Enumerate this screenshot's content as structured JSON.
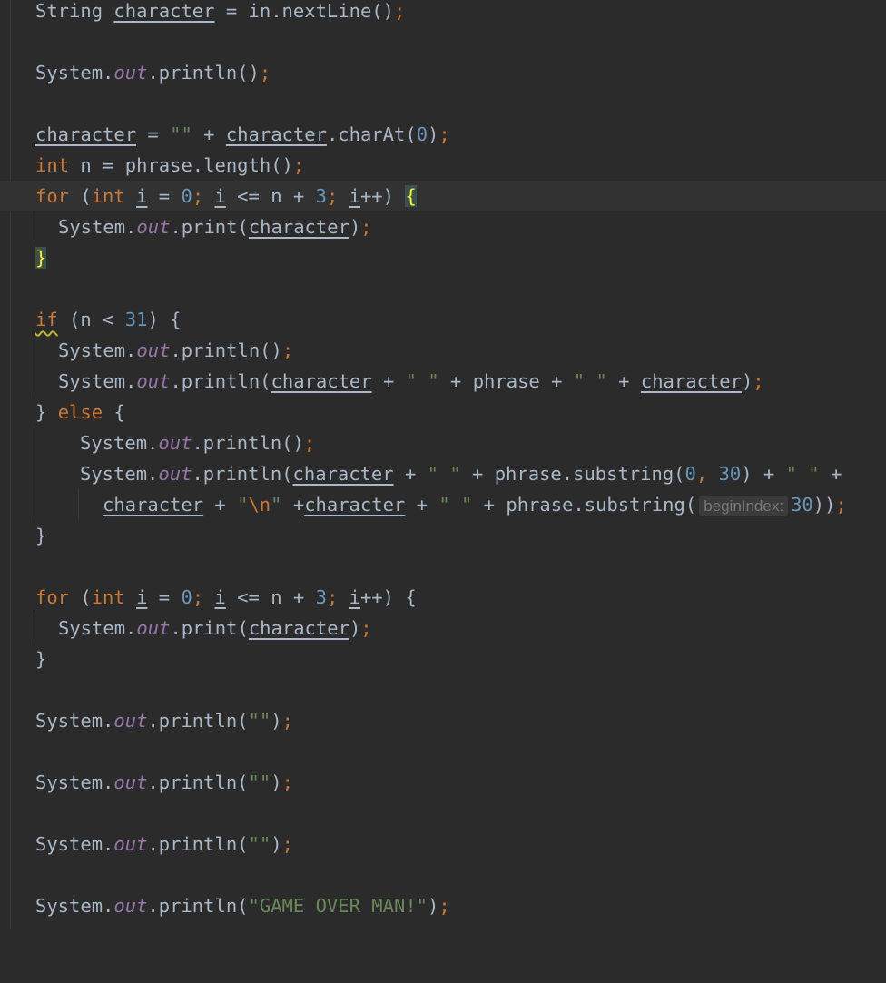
{
  "editor": {
    "theme_colors": {
      "background": "#2b2b2b",
      "keyword": "#cc7832",
      "number": "#6897bb",
      "string": "#6a8759",
      "static_field": "#9876aa",
      "default_text": "#a9b7c6",
      "brace_match": "#ffef28"
    },
    "lines": {
      "l1": {
        "t1": "String ",
        "t2": "character",
        "t3": " = in.nextLine()",
        "t4": ";"
      },
      "l2": {
        "t1": "System.",
        "t2": "out",
        "t3": ".println()",
        "t4": ";"
      },
      "l3": {
        "t1": "character",
        "t2": " = ",
        "t3": "\"\"",
        "t4": " + ",
        "t5": "character",
        "t6": ".charAt(",
        "t7": "0",
        "t8": ")",
        "t9": ";"
      },
      "l4": {
        "t1": "int",
        "t2": " n = phrase.length()",
        "t3": ";"
      },
      "l5": {
        "t1": "for",
        "t2": " (",
        "t3": "int",
        "t4": " ",
        "t5": "i",
        "t6": " = ",
        "t7": "0",
        "t8": "; ",
        "t9": "i",
        "t10": " <= n + ",
        "t11": "3",
        "t12": "; ",
        "t13": "i",
        "t14": "++) ",
        "t15": "{"
      },
      "l6": {
        "t1": "System.",
        "t2": "out",
        "t3": ".print(",
        "t4": "character",
        "t5": ")",
        "t6": ";"
      },
      "l7": {
        "t1": "}"
      },
      "l8": {
        "t1": "if",
        "t2": " (n < ",
        "t3": "31",
        "t4": ") {"
      },
      "l9": {
        "t1": "System.",
        "t2": "out",
        "t3": ".println()",
        "t4": ";"
      },
      "l10": {
        "t1": "System.",
        "t2": "out",
        "t3": ".println(",
        "t4": "character",
        "t5": " + ",
        "t6": "\" \"",
        "t7": " + phrase + ",
        "t8": "\" \"",
        "t9": " + ",
        "t10": "character",
        "t11": ")",
        "t12": ";"
      },
      "l11": {
        "t1": "} ",
        "t2": "else",
        "t3": " {"
      },
      "l12": {
        "t1": "System.",
        "t2": "out",
        "t3": ".println()",
        "t4": ";"
      },
      "l13": {
        "t1": "System.",
        "t2": "out",
        "t3": ".println(",
        "t4": "character",
        "t5": " + ",
        "t6": "\" \"",
        "t7": " + phrase.substring(",
        "t8": "0",
        "t9": ", ",
        "t10": "30",
        "t11": ") + ",
        "t12": "\" \"",
        "t13": " +"
      },
      "l14": {
        "t1": "character",
        "t2": " + ",
        "t3": "\"",
        "t4": "\\n",
        "t5": "\"",
        "t6": " +",
        "t7": "character",
        "t8": " + ",
        "t9": "\" \"",
        "t10": " + phrase.substring(",
        "hint": "beginIndex:",
        "t11": "30",
        "t12": "))",
        "t13": ";"
      },
      "l15": {
        "t1": "}"
      },
      "l16": {
        "t1": "for",
        "t2": " (",
        "t3": "int",
        "t4": " ",
        "t5": "i",
        "t6": " = ",
        "t7": "0",
        "t8": "; ",
        "t9": "i",
        "t10": " <= n + ",
        "t11": "3",
        "t12": "; ",
        "t13": "i",
        "t14": "++) {"
      },
      "l17": {
        "t1": "System.",
        "t2": "out",
        "t3": ".print(",
        "t4": "character",
        "t5": ")",
        "t6": ";"
      },
      "l18": {
        "t1": "}"
      },
      "l19": {
        "t1": "System.",
        "t2": "out",
        "t3": ".println(",
        "t4": "\"\"",
        "t5": ")",
        "t6": ";"
      },
      "l20": {
        "t1": "System.",
        "t2": "out",
        "t3": ".println(",
        "t4": "\"\"",
        "t5": ")",
        "t6": ";"
      },
      "l21": {
        "t1": "System.",
        "t2": "out",
        "t3": ".println(",
        "t4": "\"\"",
        "t5": ")",
        "t6": ";"
      },
      "l22": {
        "t1": "System.",
        "t2": "out",
        "t3": ".println(",
        "t4": "\"GAME OVER MAN!\"",
        "t5": ")",
        "t6": ";"
      }
    }
  }
}
